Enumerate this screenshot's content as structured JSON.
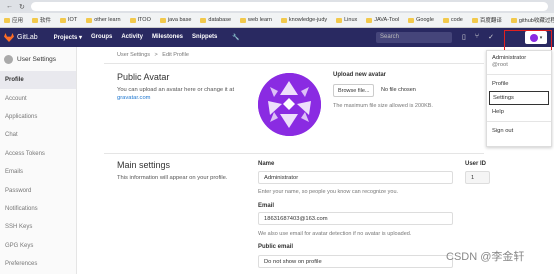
{
  "browser": {
    "bookmarks": [
      "应用",
      "软件",
      "IOT",
      "other learn",
      "ITOO",
      "java base",
      "database",
      "web learn",
      "knowledge-judy",
      "Linux",
      "JAVA-Tool",
      "Google",
      "code",
      "百度翻译",
      "github收藏过程"
    ]
  },
  "header": {
    "brand": "GitLab",
    "nav": [
      "Projects ▾",
      "Groups",
      "Activity",
      "Milestones",
      "Snippets"
    ],
    "search_placeholder": "Search"
  },
  "sidebar": {
    "title": "User Settings",
    "items": [
      "Profile",
      "Account",
      "Applications",
      "Chat",
      "Access Tokens",
      "Emails",
      "Password",
      "Notifications",
      "SSH Keys",
      "GPG Keys",
      "Preferences"
    ]
  },
  "breadcrumb": {
    "parent": "User Settings",
    "sep": ">",
    "current": "Edit Profile"
  },
  "avatar_section": {
    "title": "Public Avatar",
    "desc": "You can upload an avatar here or change it at",
    "link": "gravatar.com",
    "upload_label": "Upload new avatar",
    "browse_button": "Browse file...",
    "no_file": "No file chosen",
    "max_size": "The maximum file size allowed is 200KB."
  },
  "main_settings": {
    "title": "Main settings",
    "desc": "This information will appear on your profile.",
    "name_label": "Name",
    "name_value": "Administrator",
    "name_help": "Enter your name, so people you know can recognize you.",
    "userid_label": "User ID",
    "userid_value": "1",
    "email_label": "Email",
    "email_value": "18631687403@163.com",
    "email_help": "We also use email for avatar detection if no avatar is uploaded.",
    "public_email_label": "Public email",
    "public_email_value": "Do not show on profile"
  },
  "dropdown": {
    "name": "Administrator",
    "handle": "@root",
    "items": [
      "Profile",
      "Settings",
      "Help",
      "Sign out"
    ]
  },
  "watermark": "CSDN @李金轩",
  "colors": {
    "header_bg": "#292961",
    "avatar": "#8a2be2",
    "link": "#1f78d1",
    "highlight": "#e02020"
  }
}
